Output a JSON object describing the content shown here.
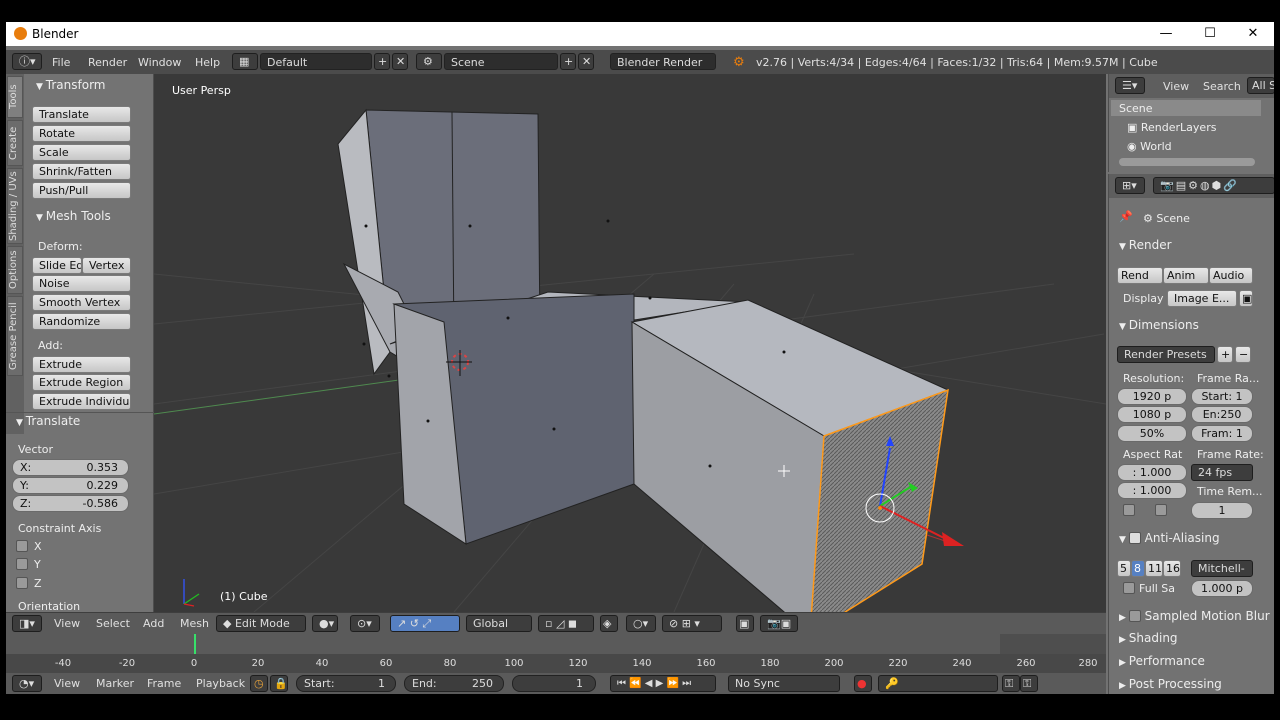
{
  "window": {
    "title": "Blender",
    "controls": [
      "—",
      "☐",
      "✕"
    ]
  },
  "info": {
    "menus": [
      "File",
      "Render",
      "Window",
      "Help"
    ],
    "screen": "Default",
    "scene": "Scene",
    "engine": "Blender Render",
    "stats": "v2.76 | Verts:4/34 | Edges:4/64 | Faces:1/32 | Tris:64 | Mem:9.57M | Cube"
  },
  "tools": {
    "tabs": [
      "Tools",
      "Create",
      "Shading / UVs",
      "Options",
      "Grease Pencil"
    ],
    "transform_header": "Transform",
    "transform": [
      "Translate",
      "Rotate",
      "Scale",
      "Shrink/Fatten",
      "Push/Pull"
    ],
    "mesh_header": "Mesh Tools",
    "deform_label": "Deform:",
    "slide_edge": "Slide Ed",
    "vertex": "Vertex",
    "mesh": [
      "Noise",
      "Smooth Vertex",
      "Randomize"
    ],
    "add_label": "Add:",
    "extrude": "Extrude",
    "extrude_more": [
      "Extrude Region",
      "Extrude Individual"
    ],
    "op_header": "Translate",
    "vector_label": "Vector",
    "vector": [
      {
        "k": "X:",
        "v": "0.353"
      },
      {
        "k": "Y:",
        "v": "0.229"
      },
      {
        "k": "Z:",
        "v": "-0.586"
      }
    ],
    "constraint_label": "Constraint Axis",
    "axes": [
      "X",
      "Y",
      "Z"
    ],
    "orientation_label": "Orientation"
  },
  "viewport": {
    "label": "User Persp",
    "object": "(1) Cube"
  },
  "header3d": {
    "menus": [
      "View",
      "Select",
      "Add",
      "Mesh"
    ],
    "mode": "Edit Mode",
    "orientation": "Global"
  },
  "timeline": {
    "ticks": [
      "-40",
      "-20",
      "0",
      "20",
      "40",
      "60",
      "80",
      "100",
      "120",
      "140",
      "160",
      "180",
      "200",
      "220",
      "240",
      "260",
      "280"
    ],
    "menus": [
      "View",
      "Marker",
      "Frame",
      "Playback"
    ],
    "start_label": "Start:",
    "start": "1",
    "end_label": "End:",
    "end": "250",
    "current": "1",
    "sync": "No Sync"
  },
  "outliner": {
    "menus": [
      "View",
      "Search",
      "All Sc"
    ],
    "items": [
      "Scene",
      "RenderLayers",
      "World"
    ]
  },
  "properties": {
    "context": "Scene",
    "render": "Render",
    "render_btns": [
      "Rend",
      "Anim",
      "Audio"
    ],
    "display_label": "Display",
    "display": "Image E...",
    "dimensions": "Dimensions",
    "presets": "Render Presets",
    "resolution_label": "Resolution:",
    "frame_range_label": "Frame Ra...",
    "res_x": "1920 p",
    "res_y": "1080 p",
    "res_pct": "50%",
    "start": "Start: 1",
    "end": "En:250",
    "frame": "Fram: 1",
    "aspect_label": "Aspect Rat",
    "frame_rate_label": "Frame Rate:",
    "aspect_x": ": 1.000",
    "aspect_y": ": 1.000",
    "fps": "24 fps",
    "time_remap": "Time Rem...",
    "time_val": "1",
    "aa": "Anti-Aliasing",
    "aa_samples": [
      "5",
      "8",
      "11",
      "16"
    ],
    "aa_filter": "Mitchell-",
    "full_sample": "Full Sa",
    "filter_size": "1.000 p",
    "sampled_motion": "Sampled Motion Blur",
    "closed": [
      "Shading",
      "Performance",
      "Post Processing"
    ]
  },
  "colors": {
    "accent": "#5680c2",
    "select": "#ffaa33"
  }
}
